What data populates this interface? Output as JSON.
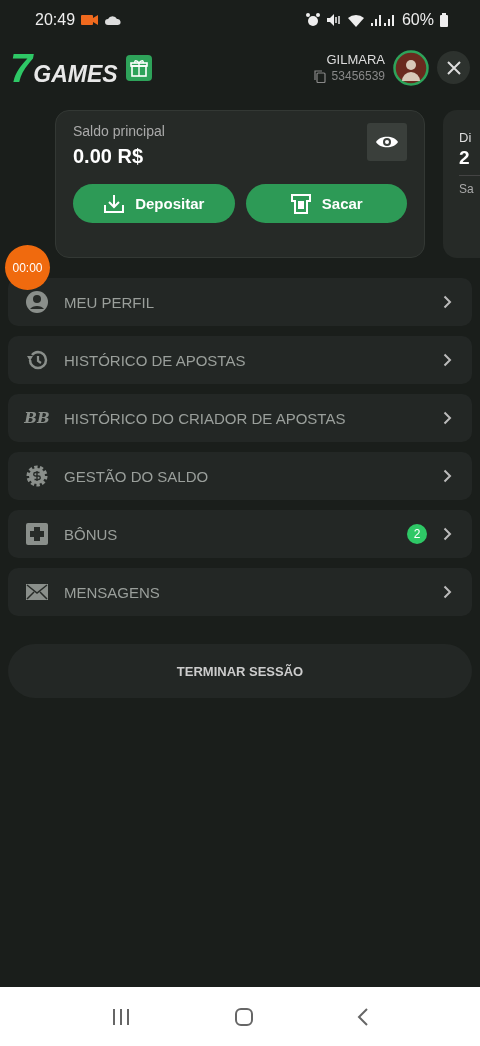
{
  "status_bar": {
    "time": "20:49",
    "battery": "60%"
  },
  "header": {
    "logo": {
      "mark": "7",
      "word": "GAMES"
    },
    "user": {
      "name": "GILMARA",
      "id": "53456539"
    }
  },
  "balance_cards": [
    {
      "label": "Saldo principal",
      "amount": "0.00 R$",
      "buttons": [
        {
          "kind": "deposit",
          "label": "Depositar"
        },
        {
          "kind": "withdraw",
          "label": "Sacar"
        }
      ]
    },
    {
      "label": "Di",
      "amount": "2",
      "note": "Sa"
    }
  ],
  "recorder_badge": "00:00",
  "menu": [
    {
      "kind": "profile",
      "label": "MEU PERFIL"
    },
    {
      "kind": "history",
      "label": "HISTÓRICO DE APOSTAS"
    },
    {
      "kind": "builder",
      "label": "HISTÓRICO DO CRIADOR DE APOSTAS",
      "icon_text": "BB"
    },
    {
      "kind": "balance",
      "label": "GESTÃO DO SALDO"
    },
    {
      "kind": "bonus",
      "label": "BÔNUS",
      "badge": "2"
    },
    {
      "kind": "messages",
      "label": "MENSAGENS"
    }
  ],
  "logout": "TERMINAR SESSÃO"
}
